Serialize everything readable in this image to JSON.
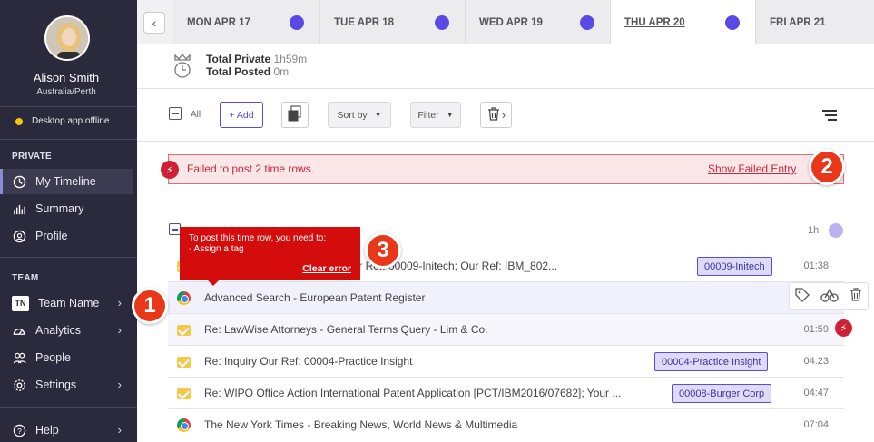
{
  "sidebar": {
    "user": {
      "name": "Alison Smith",
      "timezone": "Australia/Perth"
    },
    "status": "Desktop app offline",
    "sections": {
      "private": "PRIVATE",
      "team": "TEAM"
    },
    "private_items": [
      {
        "label": "My Timeline",
        "icon": "clock-icon",
        "active": true
      },
      {
        "label": "Summary",
        "icon": "bar-chart-icon"
      },
      {
        "label": "Profile",
        "icon": "profile-icon"
      }
    ],
    "team_items": [
      {
        "label": "Team Name",
        "badge": "TN"
      },
      {
        "label": "Analytics",
        "icon": "speedometer-icon"
      },
      {
        "label": "People",
        "icon": "people-icon"
      },
      {
        "label": "Settings",
        "icon": "gear-icon"
      }
    ],
    "help": "Help"
  },
  "tabs": [
    {
      "label": "MON APR 17"
    },
    {
      "label": "TUE APR 18"
    },
    {
      "label": "WED APR 19"
    },
    {
      "label": "THU APR 20",
      "active": true
    },
    {
      "label": "FRI APR 21"
    }
  ],
  "totals": {
    "private_label": "Total Private",
    "private_value": "1h59m",
    "posted_label": "Total Posted",
    "posted_value": "0m"
  },
  "toolbar": {
    "all_label": "All",
    "add_label": "+ Add",
    "sort_label": "Sort by",
    "filter_label": "Filter"
  },
  "error": {
    "message": "Failed to post 2 time rows.",
    "link": "Show Failed Entry"
  },
  "group": {
    "duration": "1h"
  },
  "tooltip": {
    "line1": "To post this time row, you need to:",
    "line2": "- Assign a tag",
    "link": "Clear error"
  },
  "callouts": [
    "1",
    "2",
    "3"
  ],
  "rows": [
    {
      "title": "Re: Refusal (Your Ref: 00009-Initech; Our Ref: IBM_802...",
      "tag": "00009-Initech",
      "time": "01:38",
      "icon": "mail-icon"
    },
    {
      "title": "Advanced Search - European Patent Register",
      "tag": "",
      "time": "",
      "icon": "chrome-icon"
    },
    {
      "title": "Re: LawWise Attorneys - General Terms Query - Lim & Co.",
      "tag": "",
      "time": "01:59",
      "icon": "mail-icon"
    },
    {
      "title": "Re: Inquiry Our Ref: 00004-Practice Insight",
      "tag": "00004-Practice Insight",
      "time": "04:23",
      "icon": "mail-icon"
    },
    {
      "title": "Re: WIPO Office Action International Patent Application [PCT/IBM2016/07682]; Your ...",
      "tag": "00008-Burger Corp",
      "time": "04:47",
      "icon": "mail-icon"
    },
    {
      "title": "The New York Times - Breaking News, World News & Multimedia",
      "tag": "",
      "time": "07:04",
      "icon": "chrome-icon"
    }
  ],
  "colors": {
    "accent": "#5a4ae3",
    "sidebar_bg": "#2b2a3d",
    "error": "#d02134",
    "callout": "#e83819"
  }
}
